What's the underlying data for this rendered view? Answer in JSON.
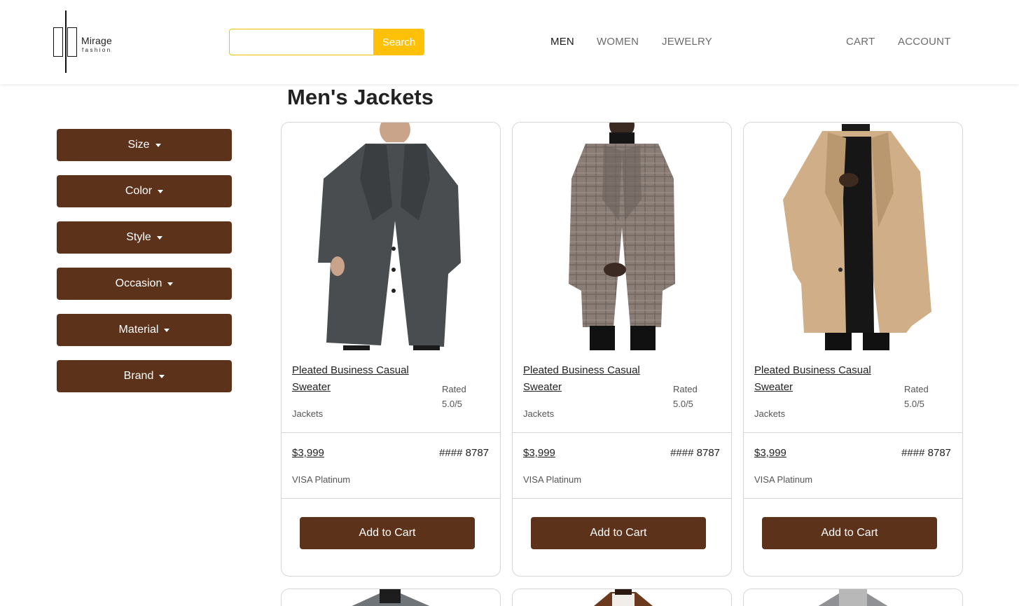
{
  "brand": {
    "name": "Mirage",
    "tagline": "fashion"
  },
  "search": {
    "placeholder": "",
    "value": "",
    "button_label": "Search"
  },
  "nav": {
    "items": [
      {
        "label": "MEN",
        "active": true
      },
      {
        "label": "WOMEN",
        "active": false
      },
      {
        "label": "JEWELRY",
        "active": false
      }
    ],
    "cart_label": "CART",
    "account_label": "ACCOUNT"
  },
  "filters": [
    {
      "label": "Size"
    },
    {
      "label": "Color"
    },
    {
      "label": "Style"
    },
    {
      "label": "Occasion"
    },
    {
      "label": "Material"
    },
    {
      "label": "Brand"
    }
  ],
  "page_title": "Men's Jackets",
  "products": [
    {
      "name": "Pleated Business Casual Sweater",
      "rated_label": "Rated",
      "rating": "5.0/5",
      "category": "Jackets",
      "price": "$3,999",
      "card_number": "#### 8787",
      "card_type": "VISA Platinum",
      "button_label": "Add to Cart",
      "coat_color": "#4a4d50",
      "coat_icon": "dark-gray-overcoat-image"
    },
    {
      "name": "Pleated Business Casual Sweater",
      "rated_label": "Rated",
      "rating": "5.0/5",
      "category": "Jackets",
      "price": "$3,999",
      "card_number": "#### 8787",
      "card_type": "VISA Platinum",
      "button_label": "Add to Cart",
      "coat_color": "#8a7d76",
      "coat_icon": "plaid-overcoat-image"
    },
    {
      "name": "Pleated Business Casual Sweater",
      "rated_label": "Rated",
      "rating": "5.0/5",
      "category": "Jackets",
      "price": "$3,999",
      "card_number": "#### 8787",
      "card_type": "VISA Platinum",
      "button_label": "Add to Cart",
      "coat_color": "#cfae88",
      "coat_icon": "camel-overcoat-image"
    }
  ],
  "colors": {
    "accent": "#5c321b",
    "search_button": "#ffc107",
    "search_border": "#f2c200"
  }
}
